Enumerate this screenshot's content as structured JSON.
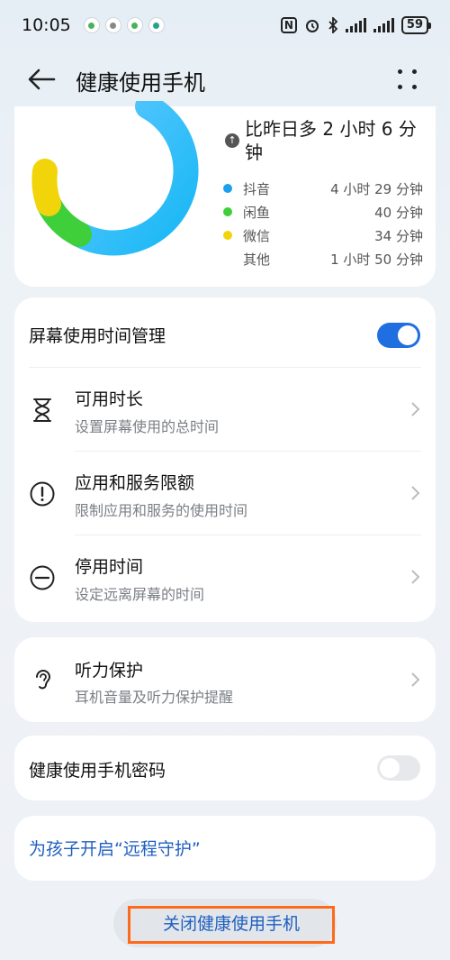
{
  "status_bar": {
    "time": "10:05",
    "nfc": "N",
    "battery": "59",
    "icons": [
      "wechat-icon",
      "camera-icon",
      "wechat-icon",
      "clock-icon",
      "nfc-icon",
      "alarm-icon",
      "bluetooth-icon",
      "signal-icon",
      "signal-icon",
      "battery-icon"
    ]
  },
  "header": {
    "title": "健康使用手机"
  },
  "usage": {
    "compare_text": "比昨日多 2 小时 6 分钟",
    "legend": [
      {
        "name": "抖音",
        "value": "4 小时 29 分钟",
        "color": "#1aa0ee"
      },
      {
        "name": "闲鱼",
        "value": "40 分钟",
        "color": "#3fcf3a"
      },
      {
        "name": "微信",
        "value": "34 分钟",
        "color": "#f2d40a"
      },
      {
        "name": "其他",
        "value": "1 小时 50 分钟",
        "color": ""
      }
    ]
  },
  "settings": {
    "screen_time": {
      "label": "屏幕使用时间管理",
      "enabled": true
    },
    "items": [
      {
        "title": "可用时长",
        "subtitle": "设置屏幕使用的总时间",
        "icon": "hourglass-icon"
      },
      {
        "title": "应用和服务限额",
        "subtitle": "限制应用和服务的使用时间",
        "icon": "alert-circle-icon"
      },
      {
        "title": "停用时间",
        "subtitle": "设定远离屏幕的时间",
        "icon": "minus-circle-icon"
      }
    ]
  },
  "hearing": {
    "title": "听力保护",
    "subtitle": "耳机音量及听力保护提醒",
    "icon": "ear-icon"
  },
  "password": {
    "label": "健康使用手机密码",
    "enabled": false
  },
  "remote": {
    "label": "为孩子开启“远程守护”"
  },
  "footer": {
    "close_label": "关闭健康使用手机",
    "highlight_color": "#ff6a1a"
  }
}
